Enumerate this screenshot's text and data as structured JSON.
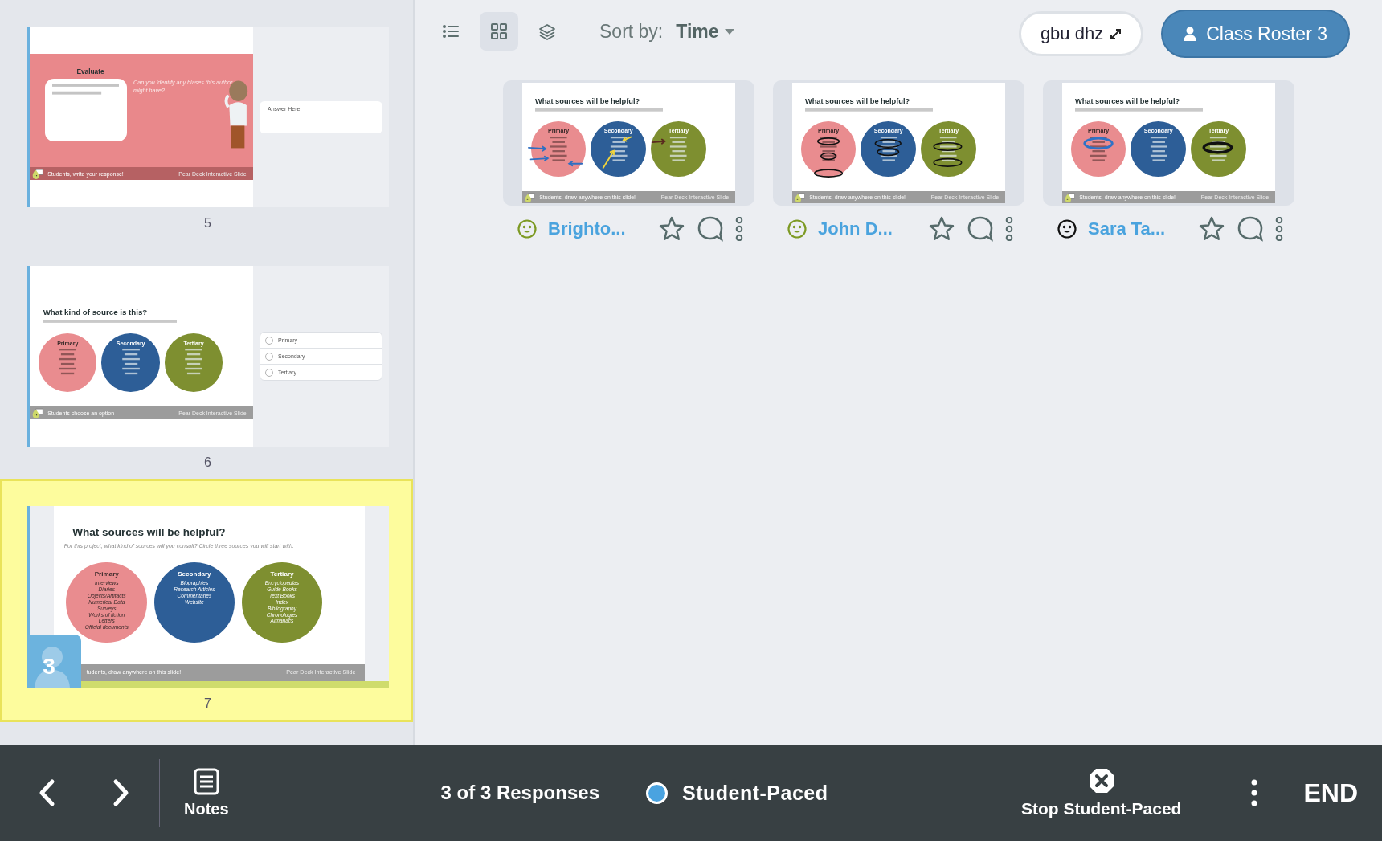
{
  "sidebar": {
    "slides": [
      {
        "number": "5",
        "selected": false,
        "kind": "text_response",
        "title": "Evaluate",
        "question": "Can you identify any biases this author might have?",
        "footer": "Students, write your response!",
        "footer_note": "Pear Deck Interactive Slide",
        "answer_placeholder": "Answer Here"
      },
      {
        "number": "6",
        "selected": false,
        "kind": "choice",
        "title": "What kind of source is this?",
        "circles": [
          {
            "name": "Primary",
            "color": "#e98c8f"
          },
          {
            "name": "Secondary",
            "color": "#2d5e97"
          },
          {
            "name": "Tertiary",
            "color": "#7e8f30"
          }
        ],
        "footer": "Students choose an option",
        "footer_note": "Pear Deck Interactive Slide",
        "options": [
          {
            "label": "Primary",
            "selected": false
          },
          {
            "label": "Secondary",
            "selected": false
          },
          {
            "label": "Tertiary",
            "selected": false
          }
        ]
      },
      {
        "number": "7",
        "selected": true,
        "kind": "drawing",
        "title": "What sources will be helpful?",
        "subtitle": "For this project, what kind of sources will you consult? Circle three sources you will start with.",
        "circles": [
          {
            "name": "Primary",
            "color": "#e98c8f",
            "items": [
              "Interviews",
              "Diaries",
              "Objects/Artifacts",
              "Numerical Data",
              "Surveys",
              "Works of fiction",
              "Letters",
              "Official documents"
            ]
          },
          {
            "name": "Secondary",
            "color": "#2d5e97",
            "items": [
              "Biographies",
              "Research Articles",
              "Commentaries",
              "Website"
            ]
          },
          {
            "name": "Tertiary",
            "color": "#7e8f30",
            "items": [
              "Encyclopedias",
              "Guide Books",
              "Text Books",
              "Index",
              "Bibliography",
              "Chronologies",
              "Almanacs"
            ]
          }
        ],
        "footer": "tudents, draw anywhere on this slide!",
        "footer_note": "Pear Deck Interactive Slide",
        "response_count": "3"
      }
    ]
  },
  "toolbar": {
    "views": [
      {
        "kind": "list",
        "selected": false
      },
      {
        "kind": "grid",
        "selected": true
      },
      {
        "kind": "layers",
        "selected": false
      }
    ],
    "sort_label": "Sort by:",
    "sort_value": "Time",
    "join_code": "gbu dhz",
    "roster_button": "Class Roster 3"
  },
  "responses": [
    {
      "name": "Brighto...",
      "color": "#7d9a24",
      "starred": false,
      "kind": "arrows",
      "slide": {
        "title": "What sources will be helpful?",
        "circles": [
          {
            "name": "Primary",
            "color": "#e98c8f"
          },
          {
            "name": "Secondary",
            "color": "#2d5e97"
          },
          {
            "name": "Tertiary",
            "color": "#7e8f30"
          }
        ],
        "footer": "Students, draw anywhere on this slide!",
        "footer_note": "Pear Deck Interactive Slide"
      }
    },
    {
      "name": "John D...",
      "color": "#7d9a24",
      "starred": false,
      "kind": "loops",
      "slide": {
        "title": "What sources will be helpful?",
        "circles": [
          {
            "name": "Primary",
            "color": "#e98c8f"
          },
          {
            "name": "Secondary",
            "color": "#2d5e97"
          },
          {
            "name": "Tertiary",
            "color": "#7e8f30"
          }
        ],
        "footer": "Students, draw anywhere on this slide!",
        "footer_note": "Pear Deck Interactive Slide"
      }
    },
    {
      "name": "Sara Ta...",
      "color": "#111111",
      "starred": false,
      "kind": "blots",
      "slide": {
        "title": "What sources will be helpful?",
        "circles": [
          {
            "name": "Primary",
            "color": "#e98c8f"
          },
          {
            "name": "Secondary",
            "color": "#2d5e97"
          },
          {
            "name": "Tertiary",
            "color": "#7e8f30"
          }
        ],
        "footer": "Students, draw anywhere on this slide!",
        "footer_note": "Pear Deck Interactive Slide"
      }
    }
  ],
  "bottom_bar": {
    "notes": "Notes",
    "responses": "3 of 3 Responses",
    "pacing": {
      "label": "Student-Paced",
      "on": true
    },
    "stop_button": "Stop Student-Paced",
    "end": "END"
  }
}
